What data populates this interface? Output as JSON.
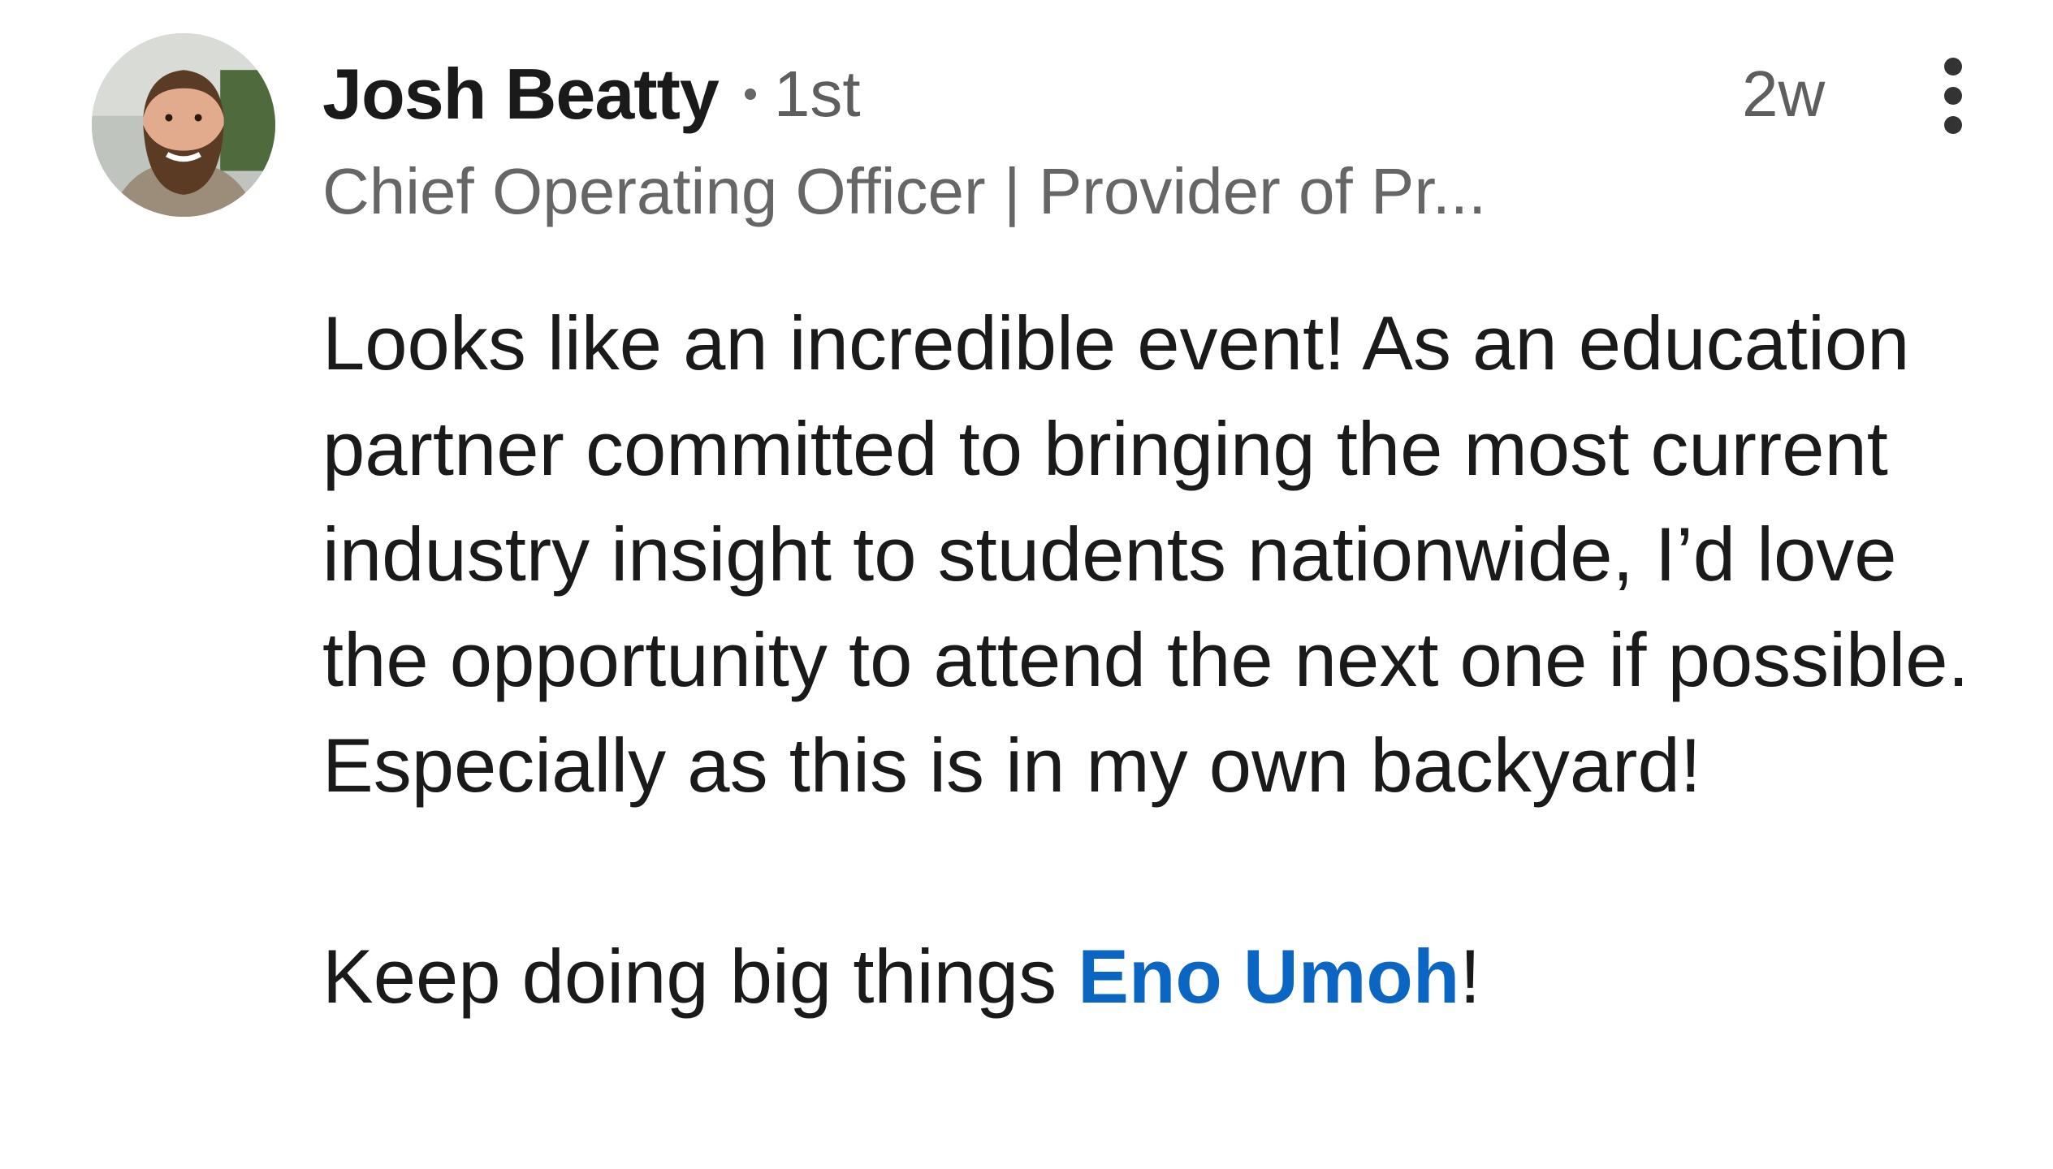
{
  "comment": {
    "author": {
      "name": "Josh Beatty",
      "connection_degree": "1st",
      "headline": "Chief Operating Officer | Provider of Pr..."
    },
    "timestamp": "2w",
    "more_icon": "vertical-ellipsis-icon",
    "body": {
      "paragraph1": "Looks like an incredible event! As an education partner committed to bringing the most current industry insight to students nationwide, I’d love the opportunity to attend the next one if possible. Especially as this is in my own backyard!",
      "paragraph2_prefix": "Keep doing big things ",
      "mention": "Eno Umoh",
      "paragraph2_suffix": "!"
    },
    "colors": {
      "mention": "#0a66c2",
      "secondary_text": "#5e5e5e",
      "primary_text": "#1a1a1a"
    }
  }
}
